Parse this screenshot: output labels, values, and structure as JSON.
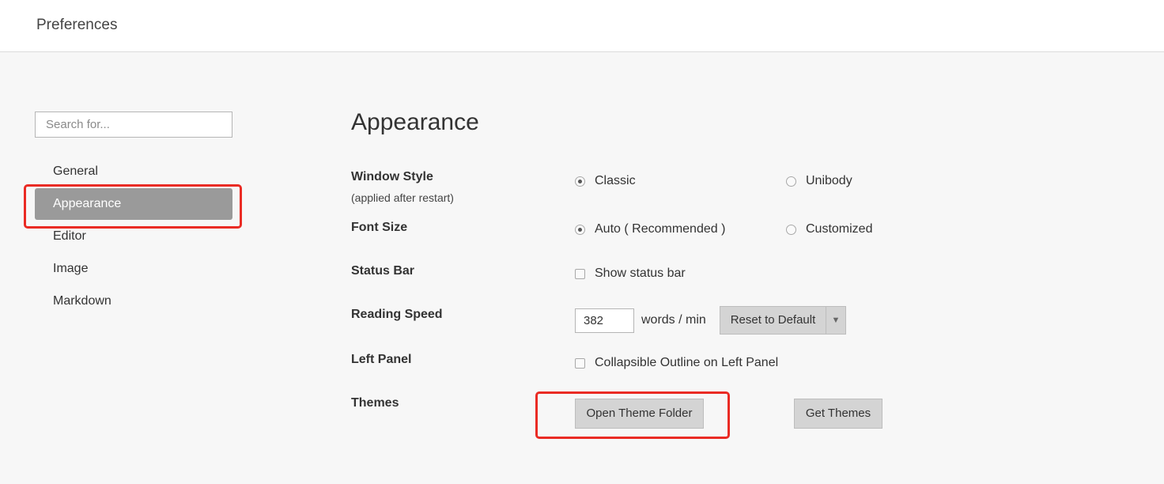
{
  "window": {
    "title": "Preferences"
  },
  "sidebar": {
    "search_placeholder": "Search for...",
    "items": [
      {
        "label": "General"
      },
      {
        "label": "Appearance",
        "active": true
      },
      {
        "label": "Editor"
      },
      {
        "label": "Image"
      },
      {
        "label": "Markdown"
      }
    ]
  },
  "main": {
    "title": "Appearance",
    "window_style": {
      "label": "Window Style",
      "note": "(applied after restart)",
      "options": [
        "Classic",
        "Unibody"
      ],
      "selected": "Classic"
    },
    "font_size": {
      "label": "Font Size",
      "options": [
        "Auto ( Recommended )",
        "Customized"
      ],
      "selected": "Auto ( Recommended )"
    },
    "status_bar": {
      "label": "Status Bar",
      "checkbox_label": "Show status bar",
      "checked": false
    },
    "reading_speed": {
      "label": "Reading Speed",
      "value": "382",
      "unit": "words / min",
      "reset_label": "Reset to Default"
    },
    "left_panel": {
      "label": "Left Panel",
      "checkbox_label": "Collapsible Outline on Left Panel",
      "checked": false
    },
    "themes": {
      "label": "Themes",
      "open_folder_label": "Open Theme Folder",
      "get_themes_label": "Get Themes"
    }
  },
  "colors": {
    "active_nav_bg": "#9a9a9a",
    "highlight": "#ea2b24",
    "button_bg": "#d4d4d4"
  }
}
